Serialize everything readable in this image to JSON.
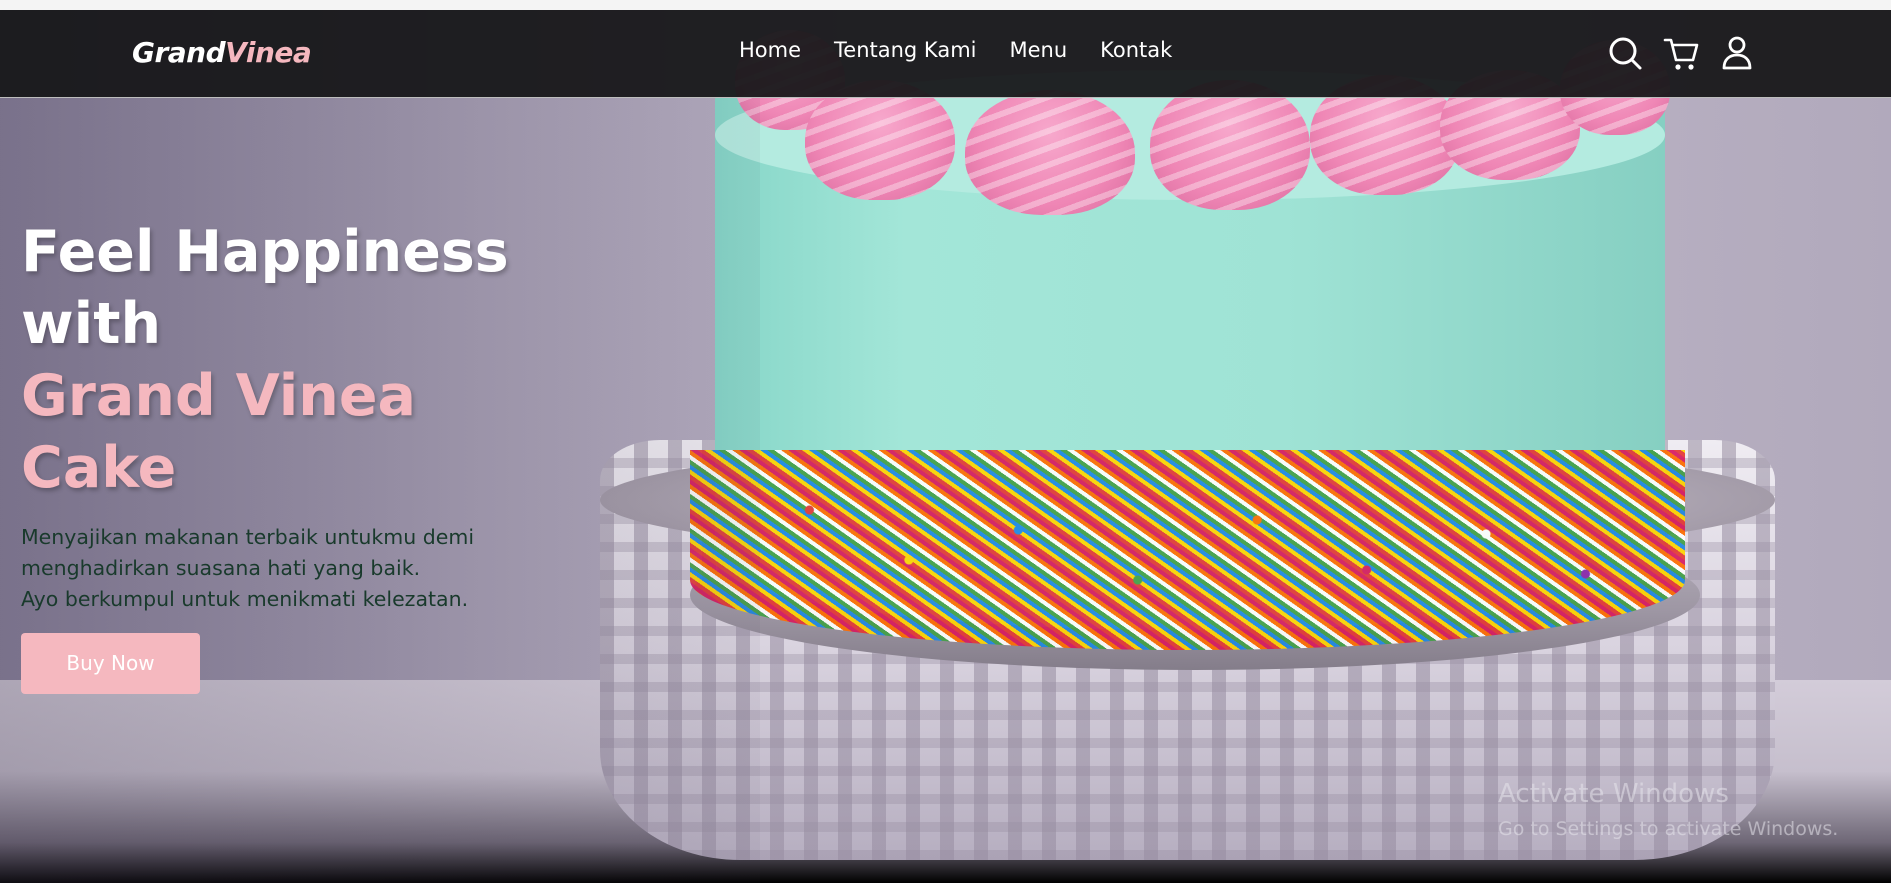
{
  "brand": {
    "name_part1": "Grand",
    "name_part2": "Vinea",
    "accent_color": "#f5b8bf"
  },
  "nav": {
    "links": [
      {
        "label": "Home"
      },
      {
        "label": "Tentang Kami"
      },
      {
        "label": "Menu"
      },
      {
        "label": "Kontak"
      }
    ],
    "icons": [
      "search-icon",
      "cart-icon",
      "user-icon"
    ]
  },
  "hero": {
    "headline_line1": "Feel Happiness",
    "headline_line2": "with",
    "headline_line3": "Grand Vinea",
    "headline_line4": "Cake",
    "sub_line1": "Menyajikan makanan terbaik untukmu demi",
    "sub_line2": "menghadirkan suasana hati yang baik.",
    "sub_line3": "Ayo berkumpul untuk menikmati kelezatan.",
    "cta_label": "Buy Now"
  },
  "watermark": {
    "title": "Activate Windows",
    "subtitle": "Go to Settings to activate Windows."
  }
}
